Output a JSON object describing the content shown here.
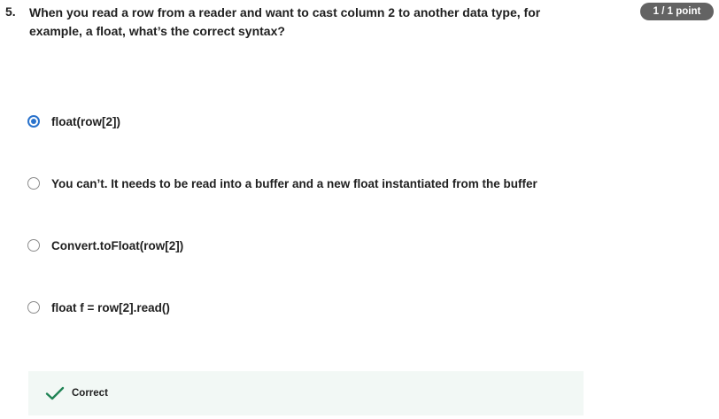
{
  "question": {
    "number": "5.",
    "text": "When you read a row from a reader and want to cast column 2 to another data type, for example, a float, what’s the correct syntax?",
    "score": "1 / 1 point"
  },
  "options": [
    {
      "label": "float(row[2])",
      "selected": true
    },
    {
      "label": "You can’t. It needs to be read into a buffer and a new float instantiated from the buffer",
      "selected": false
    },
    {
      "label": "Convert.toFloat(row[2])",
      "selected": false
    },
    {
      "label": "float f = row[2].read()",
      "selected": false
    }
  ],
  "feedback": {
    "label": "Correct",
    "icon": "check-icon"
  },
  "colors": {
    "accent": "#2a73cc",
    "success": "#1f8354",
    "badge": "#636363",
    "feedback_bg": "#f2f8f5"
  }
}
